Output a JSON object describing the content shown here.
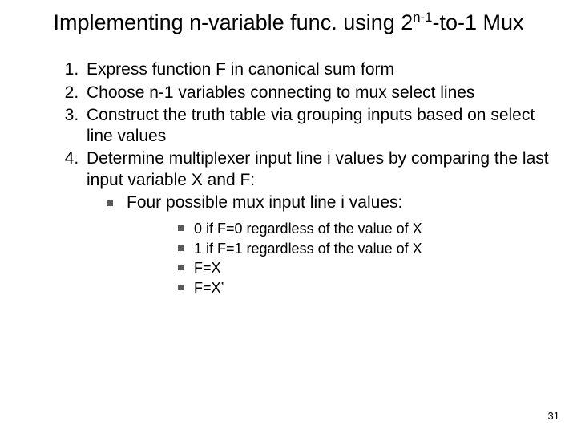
{
  "title": {
    "pre": "Implementing n-variable func. using 2",
    "sup": "n-1",
    "post": "-to-1 Mux"
  },
  "items": [
    "Express function F in canonical sum form",
    "Choose n-1 variables connecting to mux select lines",
    "Construct the truth table via grouping inputs based on select line values",
    "Determine multiplexer input line i values by comparing the last input variable X and F:"
  ],
  "sub1": "Four possible mux input line i values:",
  "sub2": [
    "0 if F=0 regardless of the value of X",
    "1 if F=1 regardless of the value of X",
    "F=X",
    "F=X’"
  ],
  "page": "31"
}
